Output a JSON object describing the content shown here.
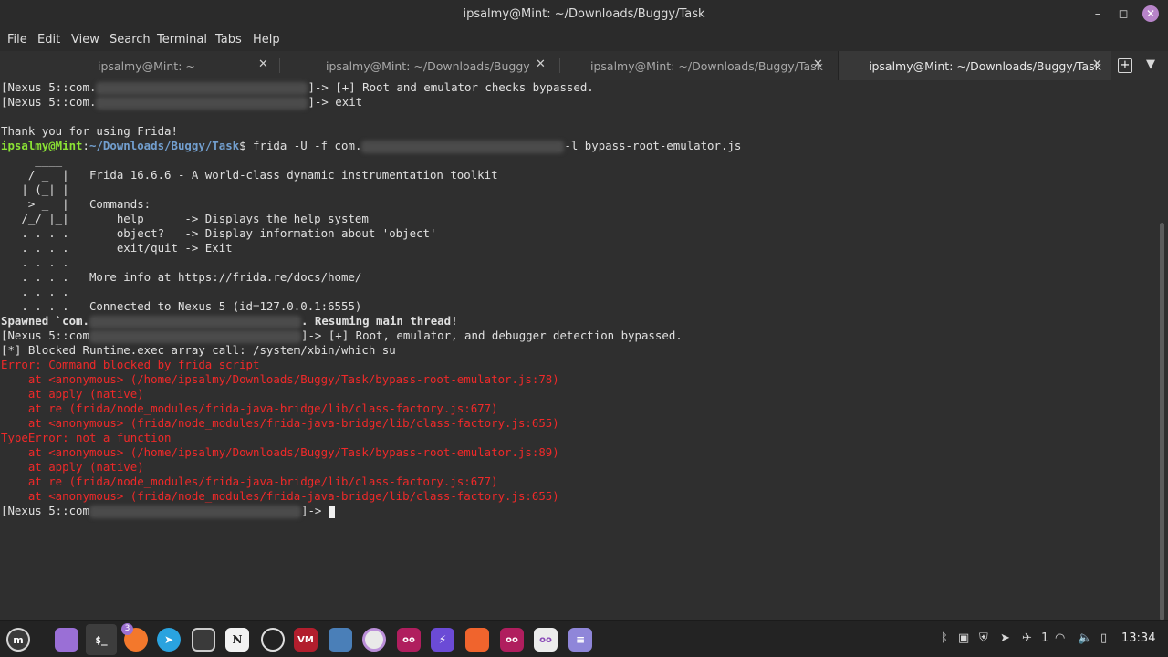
{
  "window": {
    "title": "ipsalmy@Mint: ~/Downloads/Buggy/Task"
  },
  "menu": [
    "File",
    "Edit",
    "View",
    "Search",
    "Terminal",
    "Tabs",
    "Help"
  ],
  "tabs": [
    {
      "label": "ipsalmy@Mint: ~"
    },
    {
      "label": "ipsalmy@Mint: ~/Downloads/Buggy"
    },
    {
      "label": "ipsalmy@Mint: ~/Downloads/Buggy/Task"
    },
    {
      "label": "ipsalmy@Mint: ~/Downloads/Buggy/Task",
      "active": true
    }
  ],
  "terminal": {
    "l1_prefix": "[Nexus 5::com.",
    "l1_suffix": "]-> [+] Root and emulator checks bypassed.",
    "l2_prefix": "[Nexus 5::com.",
    "l2_suffix": "]-> exit",
    "l3": "Thank you for using Frida!",
    "prompt_user": "ipsalmy@Mint",
    "prompt_colon": ":",
    "prompt_path": "~/Downloads/Buggy/Task",
    "prompt_cmd_a": "$ frida -U -f com.",
    "prompt_cmd_b": "-l bypass-root-emulator.js",
    "logo1": "     ____",
    "logo2": "    / _  |   Frida 16.6.6 - A world-class dynamic instrumentation toolkit",
    "logo3": "   | (_| |",
    "logo4": "    > _  |   Commands:",
    "logo5": "   /_/ |_|       help      -> Displays the help system",
    "logo6": "   . . . .       object?   -> Display information about 'object'",
    "logo7": "   . . . .       exit/quit -> Exit",
    "logo8": "   . . . .",
    "logo9": "   . . . .   More info at https://frida.re/docs/home/",
    "logo10": "   . . . .",
    "logo11": "   . . . .   Connected to Nexus 5 (id=127.0.0.1:6555)",
    "spawned_a": "Spawned `com.",
    "spawned_b": ". Resuming main thread!",
    "l_bypass_prefix": "[Nexus 5::com",
    "l_bypass_suffix": "]-> [+] Root, emulator, and debugger detection bypassed.",
    "l_blocked": "[*] Blocked Runtime.exec array call: /system/xbin/which su",
    "err1": "Error: Command blocked by frida script",
    "err2": "    at <anonymous> (/home/ipsalmy/Downloads/Buggy/Task/bypass-root-emulator.js:78)",
    "err3": "    at apply (native)",
    "err4": "    at re (frida/node_modules/frida-java-bridge/lib/class-factory.js:677)",
    "err5": "    at <anonymous> (frida/node_modules/frida-java-bridge/lib/class-factory.js:655)",
    "err6": "TypeError: not a function",
    "err7": "    at <anonymous> (/home/ipsalmy/Downloads/Buggy/Task/bypass-root-emulator.js:89)",
    "err8": "    at apply (native)",
    "err9": "    at re (frida/node_modules/frida-java-bridge/lib/class-factory.js:677)",
    "err10": "    at <anonymous> (frida/node_modules/frida-java-bridge/lib/class-factory.js:655)",
    "last_prefix": "[Nexus 5::com",
    "last_suffix": "]-> "
  },
  "taskbar": {
    "badge": "3",
    "tray_count": "1",
    "clock": "13:34"
  }
}
